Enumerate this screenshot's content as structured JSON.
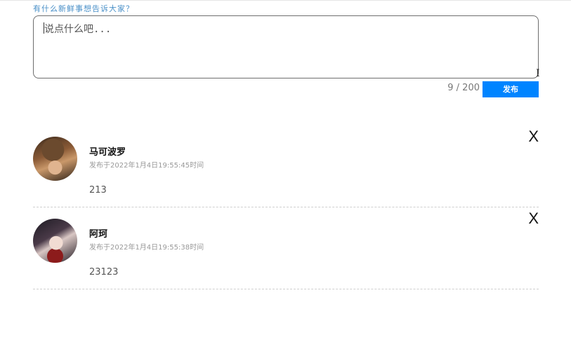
{
  "composer": {
    "prompt": "有什么新鲜事想告诉大家？",
    "placeholder": "说点什么吧...",
    "counter": "9 / 200",
    "publish_label": "发布"
  },
  "comments": [
    {
      "author": "马可波罗",
      "time": "发布于2022年1月4日19:55:45时间",
      "content": "213",
      "close_label": "X"
    },
    {
      "author": "阿珂",
      "time": "发布于2022年1月4日19:55:38时间",
      "content": "23123",
      "close_label": "X"
    }
  ],
  "colors": {
    "accent": "#0084ff",
    "prompt": "#4a90c8"
  }
}
